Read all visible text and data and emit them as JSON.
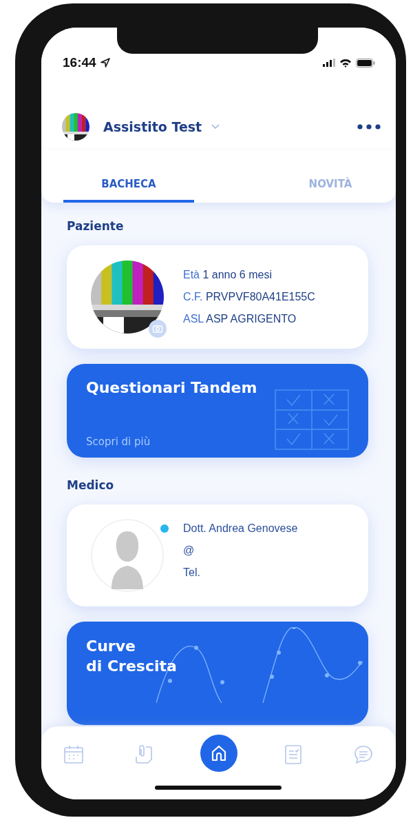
{
  "status_bar": {
    "time": "16:44"
  },
  "header": {
    "name": "Assistito Test"
  },
  "tabs": [
    {
      "label": "BACHECA",
      "selected": true
    },
    {
      "label": "NOVITÀ",
      "selected": false
    }
  ],
  "patient": {
    "heading": "Paziente",
    "fields": [
      {
        "label": "Età",
        "value": "1 anno 6 mesi"
      },
      {
        "label": "C.F.",
        "value": "PRVPVF80A41E155C"
      },
      {
        "label": "ASL",
        "value": "ASP AGRIGENTO"
      }
    ]
  },
  "tandem_card": {
    "title": "Questionari Tandem",
    "link": "Scopri di più"
  },
  "doctor": {
    "heading": "Medico",
    "online": true,
    "lines": [
      "Dott. Andrea Genovese",
      "@",
      "Tel."
    ]
  },
  "growth_card": {
    "title_lines": [
      "Curve",
      "di Crescita"
    ]
  },
  "bottom_nav": [
    {
      "kind": "calendar",
      "selected": false
    },
    {
      "kind": "document",
      "selected": false
    },
    {
      "kind": "home",
      "selected": true
    },
    {
      "kind": "checklist",
      "selected": false
    },
    {
      "kind": "chat",
      "selected": false
    }
  ]
}
